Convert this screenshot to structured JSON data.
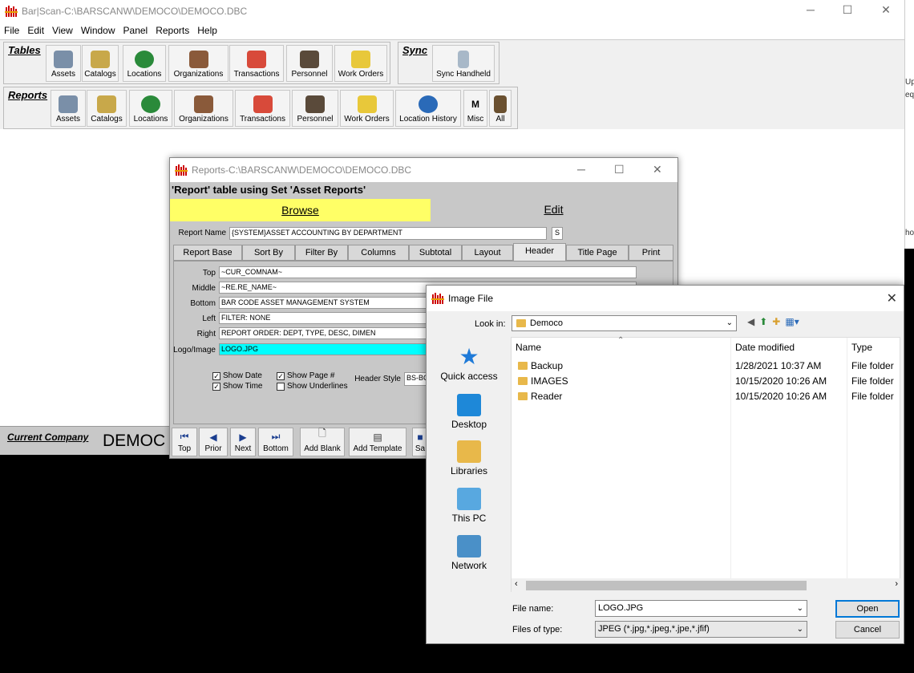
{
  "main": {
    "title": "Bar|Scan-C:\\BARSCANW\\DEMOCO\\DEMOCO.DBC",
    "menu": [
      "File",
      "Edit",
      "View",
      "Window",
      "Panel",
      "Reports",
      "Help"
    ],
    "tables_label": "Tables",
    "tables_buttons": [
      "Assets",
      "Catalogs",
      "Locations",
      "Organizations",
      "Transactions",
      "Personnel",
      "Work Orders"
    ],
    "sync_label": "Sync",
    "sync_button": "Sync Handheld",
    "reports_label": "Reports",
    "reports_buttons": [
      "Assets",
      "Catalogs",
      "Locations",
      "Organizations",
      "Transactions",
      "Personnel",
      "Work Orders",
      "Location History",
      "Misc",
      "All"
    ],
    "misc_glyph": "M",
    "company_label": "Current Company",
    "company_value": "DEMOC",
    "right_strip": [
      "Up",
      "equ",
      "hoo"
    ]
  },
  "reports": {
    "title": "Reports-C:\\BARSCANW\\DEMOCO\\DEMOCO.DBC",
    "subtitle": "'Report' table using Set 'Asset Reports'",
    "tab_browse": "Browse",
    "tab_edit": "Edit",
    "report_name_label": "Report Name",
    "report_name_value": "{SYSTEM}ASSET ACCOUNTING BY DEPARTMENT",
    "report_name_suffix": "S",
    "subtabs": [
      "Report Base",
      "Sort By",
      "Filter By",
      "Columns",
      "Subtotal",
      "Layout",
      "Header",
      "Title Page",
      "Print"
    ],
    "active_subtab": "Header",
    "fields": {
      "top_label": "Top",
      "top_value": "~CUR_COMNAM~",
      "middle_label": "Middle",
      "middle_value": "~RE.RE_NAME~",
      "bottom_label": "Bottom",
      "bottom_value": "BAR CODE ASSET MANAGEMENT SYSTEM",
      "left_label": "Left",
      "left_value": "FILTER: NONE",
      "right_label": "Right",
      "right_value": "REPORT ORDER: DEPT, TYPE, DESC, DIMEN",
      "logo_label": "Logo/Image",
      "logo_value": "LOGO.JPG"
    },
    "checkboxes": {
      "show_date": "Show Date",
      "show_time": "Show Time",
      "show_page": "Show Page #",
      "show_underlines": "Show Underlines"
    },
    "header_style_label": "Header Style",
    "header_style_value": "BS-BC",
    "nav": [
      "Top",
      "Prior",
      "Next",
      "Bottom",
      "Add Blank",
      "Add Template",
      "Sa"
    ]
  },
  "dialog": {
    "title": "Image File",
    "look_in_label": "Look in:",
    "look_in_value": "Democo",
    "places": [
      "Quick access",
      "Desktop",
      "Libraries",
      "This PC",
      "Network"
    ],
    "columns": [
      "Name",
      "Date modified",
      "Type"
    ],
    "files": [
      {
        "name": "Backup",
        "date": "1/28/2021 10:37 AM",
        "type": "File folder"
      },
      {
        "name": "IMAGES",
        "date": "10/15/2020 10:26 AM",
        "type": "File folder"
      },
      {
        "name": "Reader",
        "date": "10/15/2020 10:26 AM",
        "type": "File folder"
      }
    ],
    "file_name_label": "File name:",
    "file_name_value": "LOGO.JPG",
    "files_of_type_label": "Files of type:",
    "files_of_type_value": "JPEG (*.jpg,*.jpeg,*.jpe,*.jfif)",
    "open_label": "Open",
    "cancel_label": "Cancel"
  }
}
